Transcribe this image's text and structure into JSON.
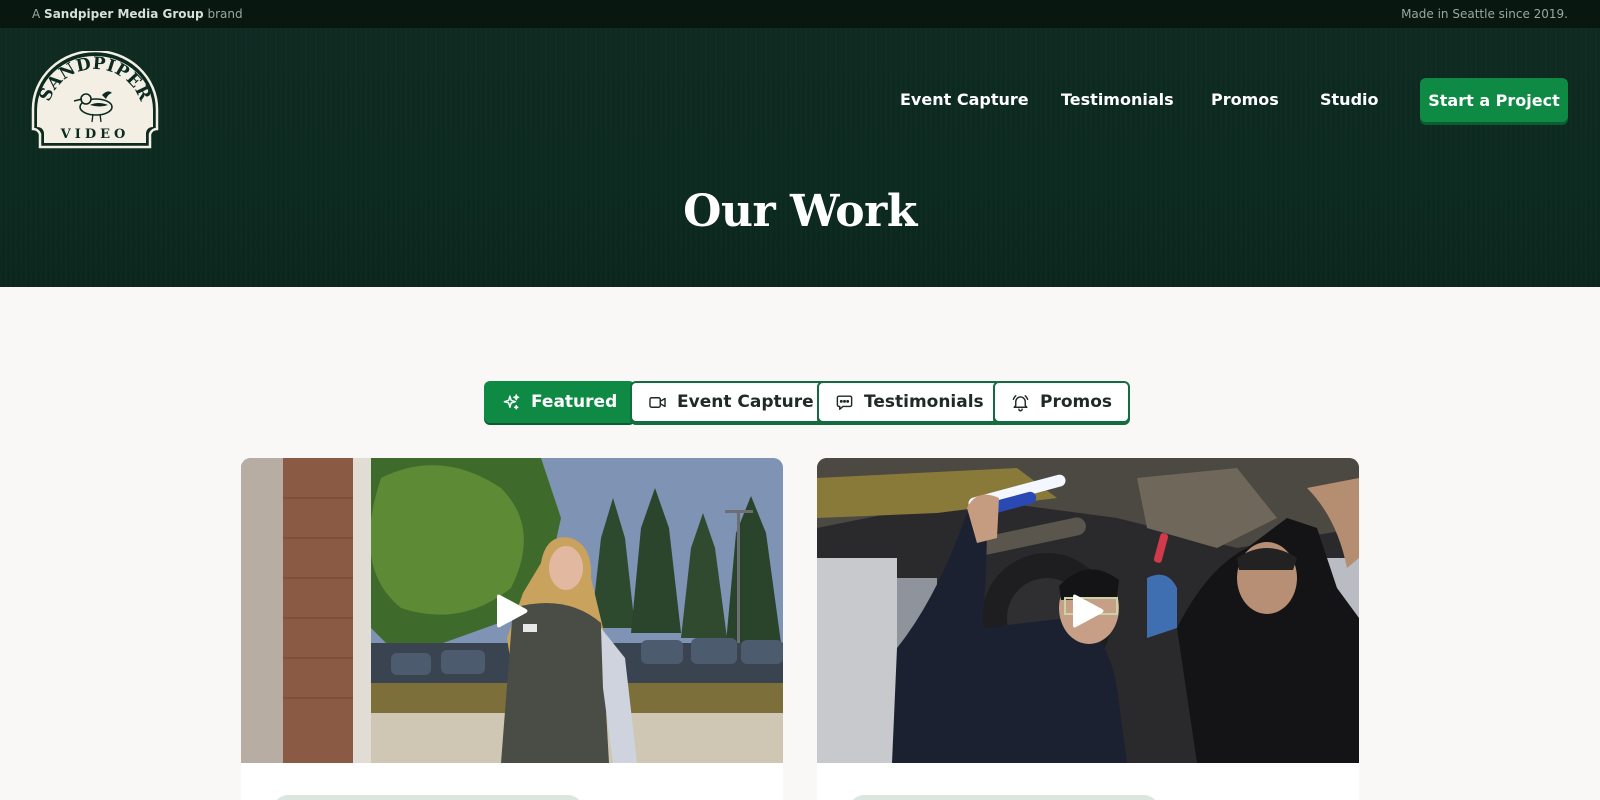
{
  "topbar": {
    "prefix": "A",
    "brand": "Sandpiper Media Group",
    "suffix": "brand",
    "tagline": "Made in Seattle since 2019."
  },
  "logo": {
    "line1": "SANDPIPER",
    "line2": "VIDEO"
  },
  "nav": {
    "items": [
      "Event Capture",
      "Testimonials",
      "Promos",
      "Studio"
    ],
    "cta": "Start a Project"
  },
  "hero": {
    "title": "Our Work"
  },
  "filters": [
    {
      "label": "Featured",
      "icon": "sparkles-icon",
      "active": true
    },
    {
      "label": "Event Capture",
      "icon": "video-camera-icon",
      "active": false
    },
    {
      "label": "Testimonials",
      "icon": "chat-bubble-icon",
      "active": false
    },
    {
      "label": "Promos",
      "icon": "bell-icon",
      "active": false
    }
  ],
  "cards": [
    {
      "thumbnail": "nurse-walking-outdoors",
      "play_icon": "play-icon"
    },
    {
      "thumbnail": "mechanics-under-vehicle",
      "play_icon": "play-icon"
    }
  ],
  "colors": {
    "hero_bg": "#0c2a20",
    "topbar_bg": "#08170f",
    "accent": "#0f8a45",
    "page_bg": "#f9f8f6"
  }
}
